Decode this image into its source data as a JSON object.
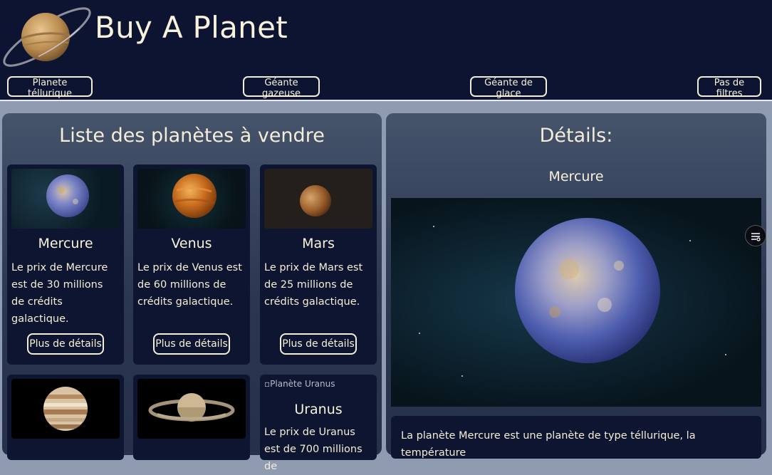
{
  "header": {
    "title": "Buy A Planet",
    "filters": [
      "Planete téllurique",
      "Géante gazeuse",
      "Géante de glace",
      "Pas de filtres"
    ]
  },
  "list_panel": {
    "title": "Liste des planètes à vendre",
    "more_label": "Plus de détails",
    "cards": [
      {
        "name": "Mercure",
        "desc": "Le prix de Mercure est de 30 millions de crédits galactique."
      },
      {
        "name": "Venus",
        "desc": "Le prix de Venus est de 60 millions de crédits galactique."
      },
      {
        "name": "Mars",
        "desc": "Le prix de Mars est de 25 millions de crédits galactique."
      },
      {
        "name": "Uranus",
        "desc": "Le prix de Uranus est de 700 millions de",
        "img_alt": "Planète Uranus"
      }
    ]
  },
  "detail_panel": {
    "title": "Détails:",
    "planet": "Mercure",
    "text": "La planète Mercure est une planète de type téllurique, la température"
  },
  "colors": {
    "header_bg": "#0d1431",
    "card_bg": "#0e1530",
    "text": "#f4eed8",
    "page_bg": "#8e9bb0"
  }
}
